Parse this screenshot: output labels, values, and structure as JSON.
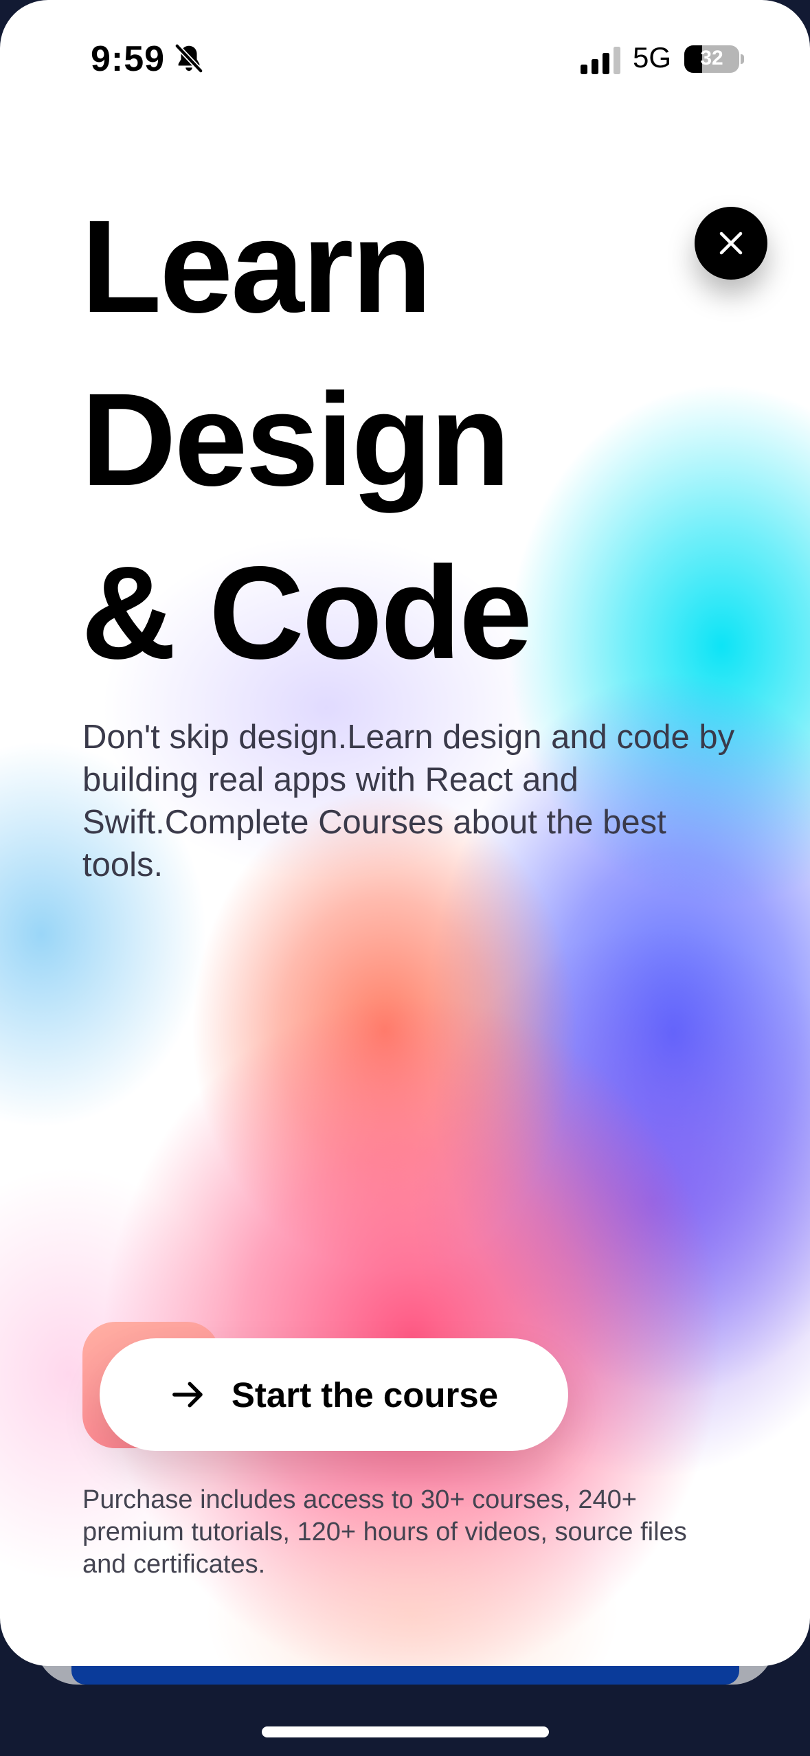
{
  "status_bar": {
    "time": "9:59",
    "silent_icon": "bell-slash-icon",
    "signal_icon": "cellular-signal-icon",
    "signal_bars_active": 3,
    "signal_bars_total": 4,
    "network": "5G",
    "battery_level": "32",
    "battery_fraction": 0.32
  },
  "close_button": {
    "icon": "close-icon"
  },
  "hero": {
    "title_line_1": "Learn",
    "title_line_2": "Design",
    "title_line_3": "& Code",
    "description": "Don't skip design.Learn design and code by building real apps with React and Swift.Complete Courses about the best tools."
  },
  "cta": {
    "icon": "arrow-right-icon",
    "label": "Start the course",
    "fineprint": "Purchase includes access to 30+ courses, 240+ premium tutorials, 120+ hours of videos, source files and certificates."
  },
  "colors": {
    "text_primary": "#000000",
    "text_secondary": "#3a3a4a",
    "accent_cyan": "#00e2f5",
    "accent_blue": "#4e5fff",
    "accent_orange": "#ff785f",
    "accent_pink": "#ff507d",
    "backdrop": "#121a33"
  }
}
